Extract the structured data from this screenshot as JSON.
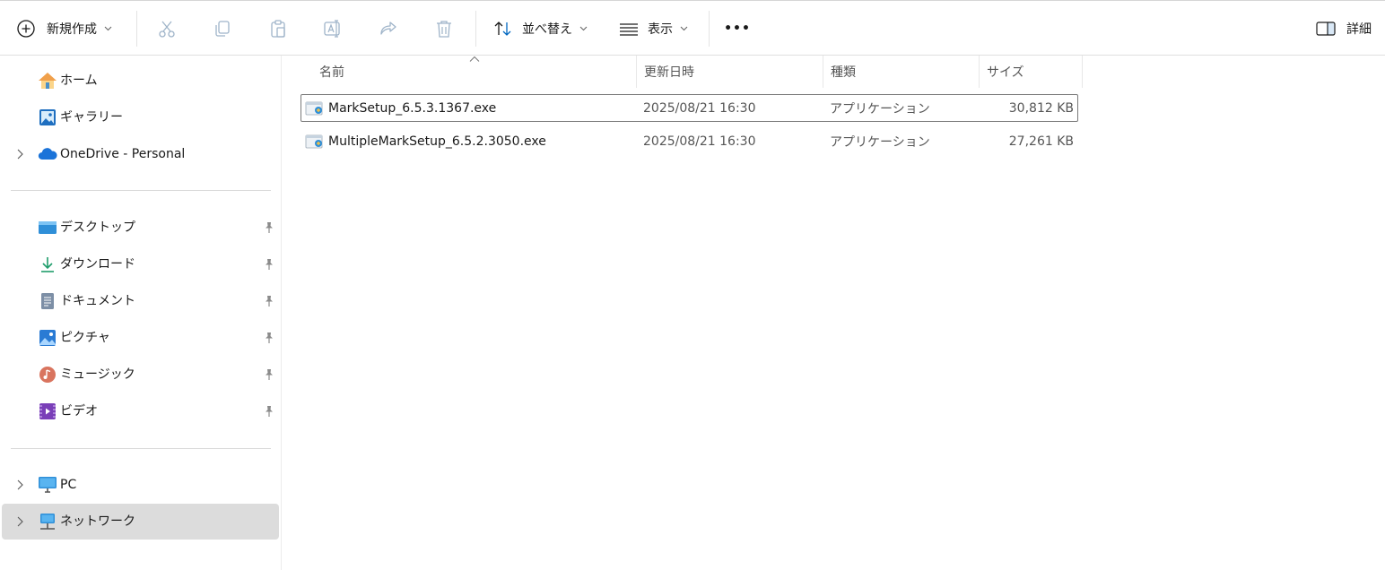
{
  "toolbar": {
    "new_label": "新規作成",
    "sort_label": "並べ替え",
    "view_label": "表示",
    "more_label": "•••",
    "details_label": "詳細"
  },
  "sidebar": {
    "home": "ホーム",
    "gallery": "ギャラリー",
    "onedrive": "OneDrive - Personal",
    "desktop": "デスクトップ",
    "downloads": "ダウンロード",
    "documents": "ドキュメント",
    "pictures": "ピクチャ",
    "music": "ミュージック",
    "videos": "ビデオ",
    "pc": "PC",
    "network": "ネットワーク"
  },
  "columns": {
    "name": "名前",
    "modified": "更新日時",
    "type": "種類",
    "size": "サイズ"
  },
  "files": [
    {
      "name": "MarkSetup_6.5.3.1367.exe",
      "modified": "2025/08/21 16:30",
      "type": "アプリケーション",
      "size": "30,812 KB"
    },
    {
      "name": "MultipleMarkSetup_6.5.2.3050.exe",
      "modified": "2025/08/21 16:30",
      "type": "アプリケーション",
      "size": "27,261 KB"
    }
  ],
  "colors": {
    "accent": "#0067c0",
    "selected_bg": "#dcdcdc",
    "disabled_icon": "#9fb4c9"
  }
}
